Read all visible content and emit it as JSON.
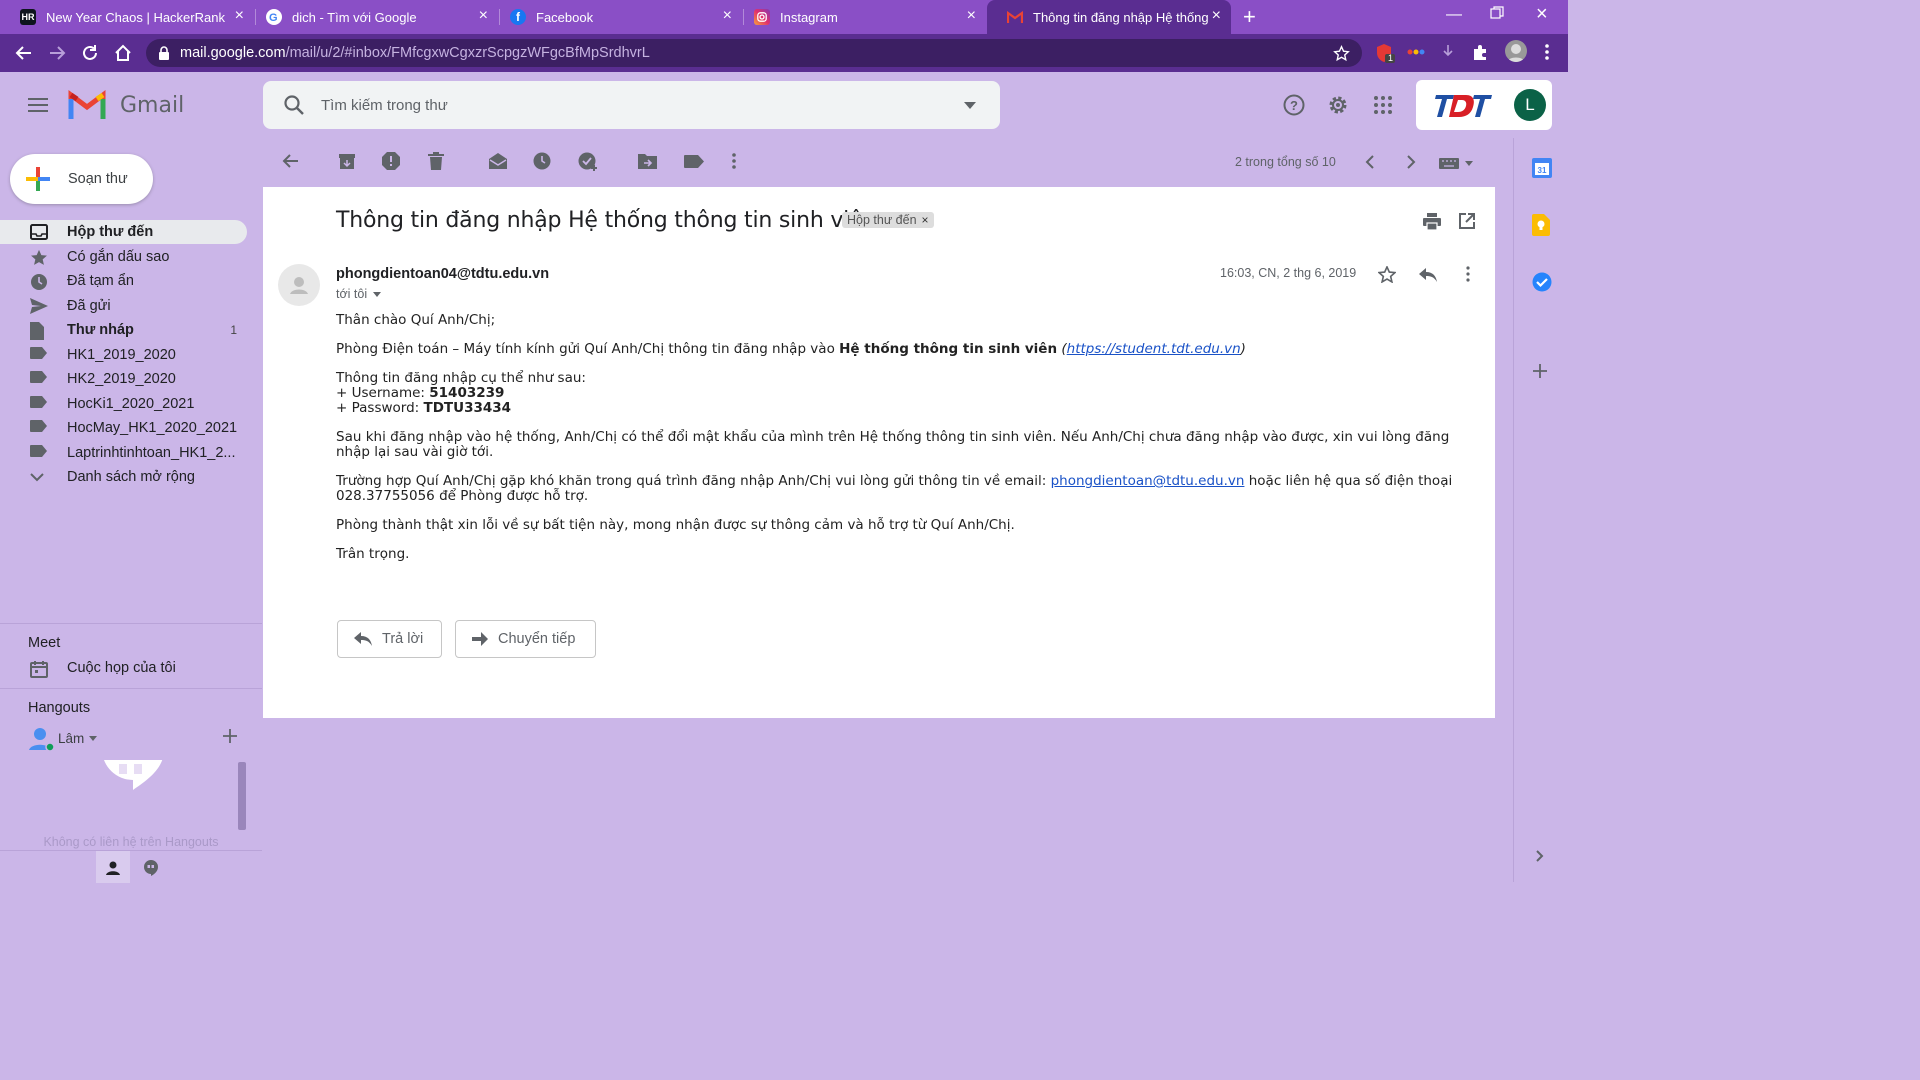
{
  "browser": {
    "tabs": [
      {
        "title": "New Year Chaos | HackerRank",
        "favicon": "hackerrank-icon"
      },
      {
        "title": "dich - Tìm với Google",
        "favicon": "google-icon"
      },
      {
        "title": "Facebook",
        "favicon": "facebook-icon"
      },
      {
        "title": "Instagram",
        "favicon": "instagram-icon"
      },
      {
        "title": "Thông tin đăng nhập Hệ thống thông tin sinh viên",
        "favicon": "gmail-icon",
        "active": true
      }
    ],
    "url_host": "mail.google.com",
    "url_path": "/mail/u/2/#inbox/FMfcgxwCgxzrScpgzWFgcBfMpSrdhvrL",
    "extension_badge": "1"
  },
  "gmail": {
    "product_name": "Gmail",
    "search_placeholder": "Tìm kiếm trong thư",
    "compose_label": "Soạn thư",
    "account_initial": "L",
    "nav": [
      {
        "label": "Hộp thư đến",
        "icon": "inbox-icon",
        "active": true,
        "count": ""
      },
      {
        "label": "Có gắn dấu sao",
        "icon": "star-icon",
        "count": ""
      },
      {
        "label": "Đã tạm ẩn",
        "icon": "clock-icon",
        "count": ""
      },
      {
        "label": "Đã gửi",
        "icon": "send-icon",
        "count": ""
      },
      {
        "label": "Thư nháp",
        "icon": "draft-icon",
        "count": "1",
        "bold": true
      },
      {
        "label": "HK1_2019_2020",
        "icon": "label-icon",
        "count": ""
      },
      {
        "label": "HK2_2019_2020",
        "icon": "label-icon",
        "count": ""
      },
      {
        "label": "HocKi1_2020_2021",
        "icon": "label-icon",
        "count": ""
      },
      {
        "label": "HocMay_HK1_2020_2021",
        "icon": "label-icon",
        "count": ""
      },
      {
        "label": "Laptrinhtinhtoan_HK1_2...",
        "icon": "label-icon",
        "count": ""
      },
      {
        "label": "Danh sách mở rộng",
        "icon": "chevron-down-icon",
        "count": ""
      }
    ],
    "meet": {
      "title": "Meet",
      "item": "Cuộc họp của tôi"
    },
    "hangouts": {
      "title": "Hangouts",
      "user": "Lâm",
      "empty_text": "Không có liên hệ trên Hangouts"
    },
    "pager": "2 trong tổng số 10"
  },
  "message": {
    "subject": "Thông tin đăng nhập Hệ thống thông tin sinh viên",
    "label": "Hộp thư đến",
    "sender": "phongdientoan04@tdtu.edu.vn",
    "to": "tới tôi",
    "date": "16:03, CN, 2 thg 6, 2019",
    "greeting": "Thân chào Quí Anh/Chị;",
    "p1_prefix": "Phòng Điện toán – Máy tính kính gửi Quí Anh/Chị thông tin đăng nhập vào ",
    "p1_bold": "Hệ thống thông tin sinh viên",
    "p1_link": "https://student.tdt.edu.vn",
    "cred_title": "Thông tin đăng nhập cụ thể như sau:",
    "username_label": "+ Username: ",
    "username": "51403239",
    "password_label": "+ Password: ",
    "password": "TDTU33434",
    "p3": "Sau khi đăng nhập vào hệ thống, Anh/Chị có thể đổi mật khẩu của mình trên Hệ thống thông tin sinh viên. Nếu Anh/Chị chưa đăng nhập vào được, xin vui lòng đăng nhập lại sau vài giờ tới.",
    "p4_prefix": "Trường hợp Quí Anh/Chị gặp khó khăn trong quá trình đăng nhập Anh/Chị vui lòng gửi thông tin về email: ",
    "p4_email": "phongdientoan@tdtu.edu.vn",
    "p4_suffix": " hoặc liên hệ qua số điện thoại 028.37755056 để Phòng được hỗ trợ.",
    "p5": "Phòng thành thật xin lỗi về sự bất tiện này, mong nhận được sự thông cảm và hỗ trợ từ Quí Anh/Chị.",
    "closing": "Trân trọng.",
    "reply_label": "Trả lời",
    "forward_label": "Chuyển tiếp"
  },
  "colors": {
    "tabbar": "#8a4fc6",
    "toolbar": "#5a2d91",
    "page": "#cbb6e8",
    "link": "#1a52c7"
  }
}
